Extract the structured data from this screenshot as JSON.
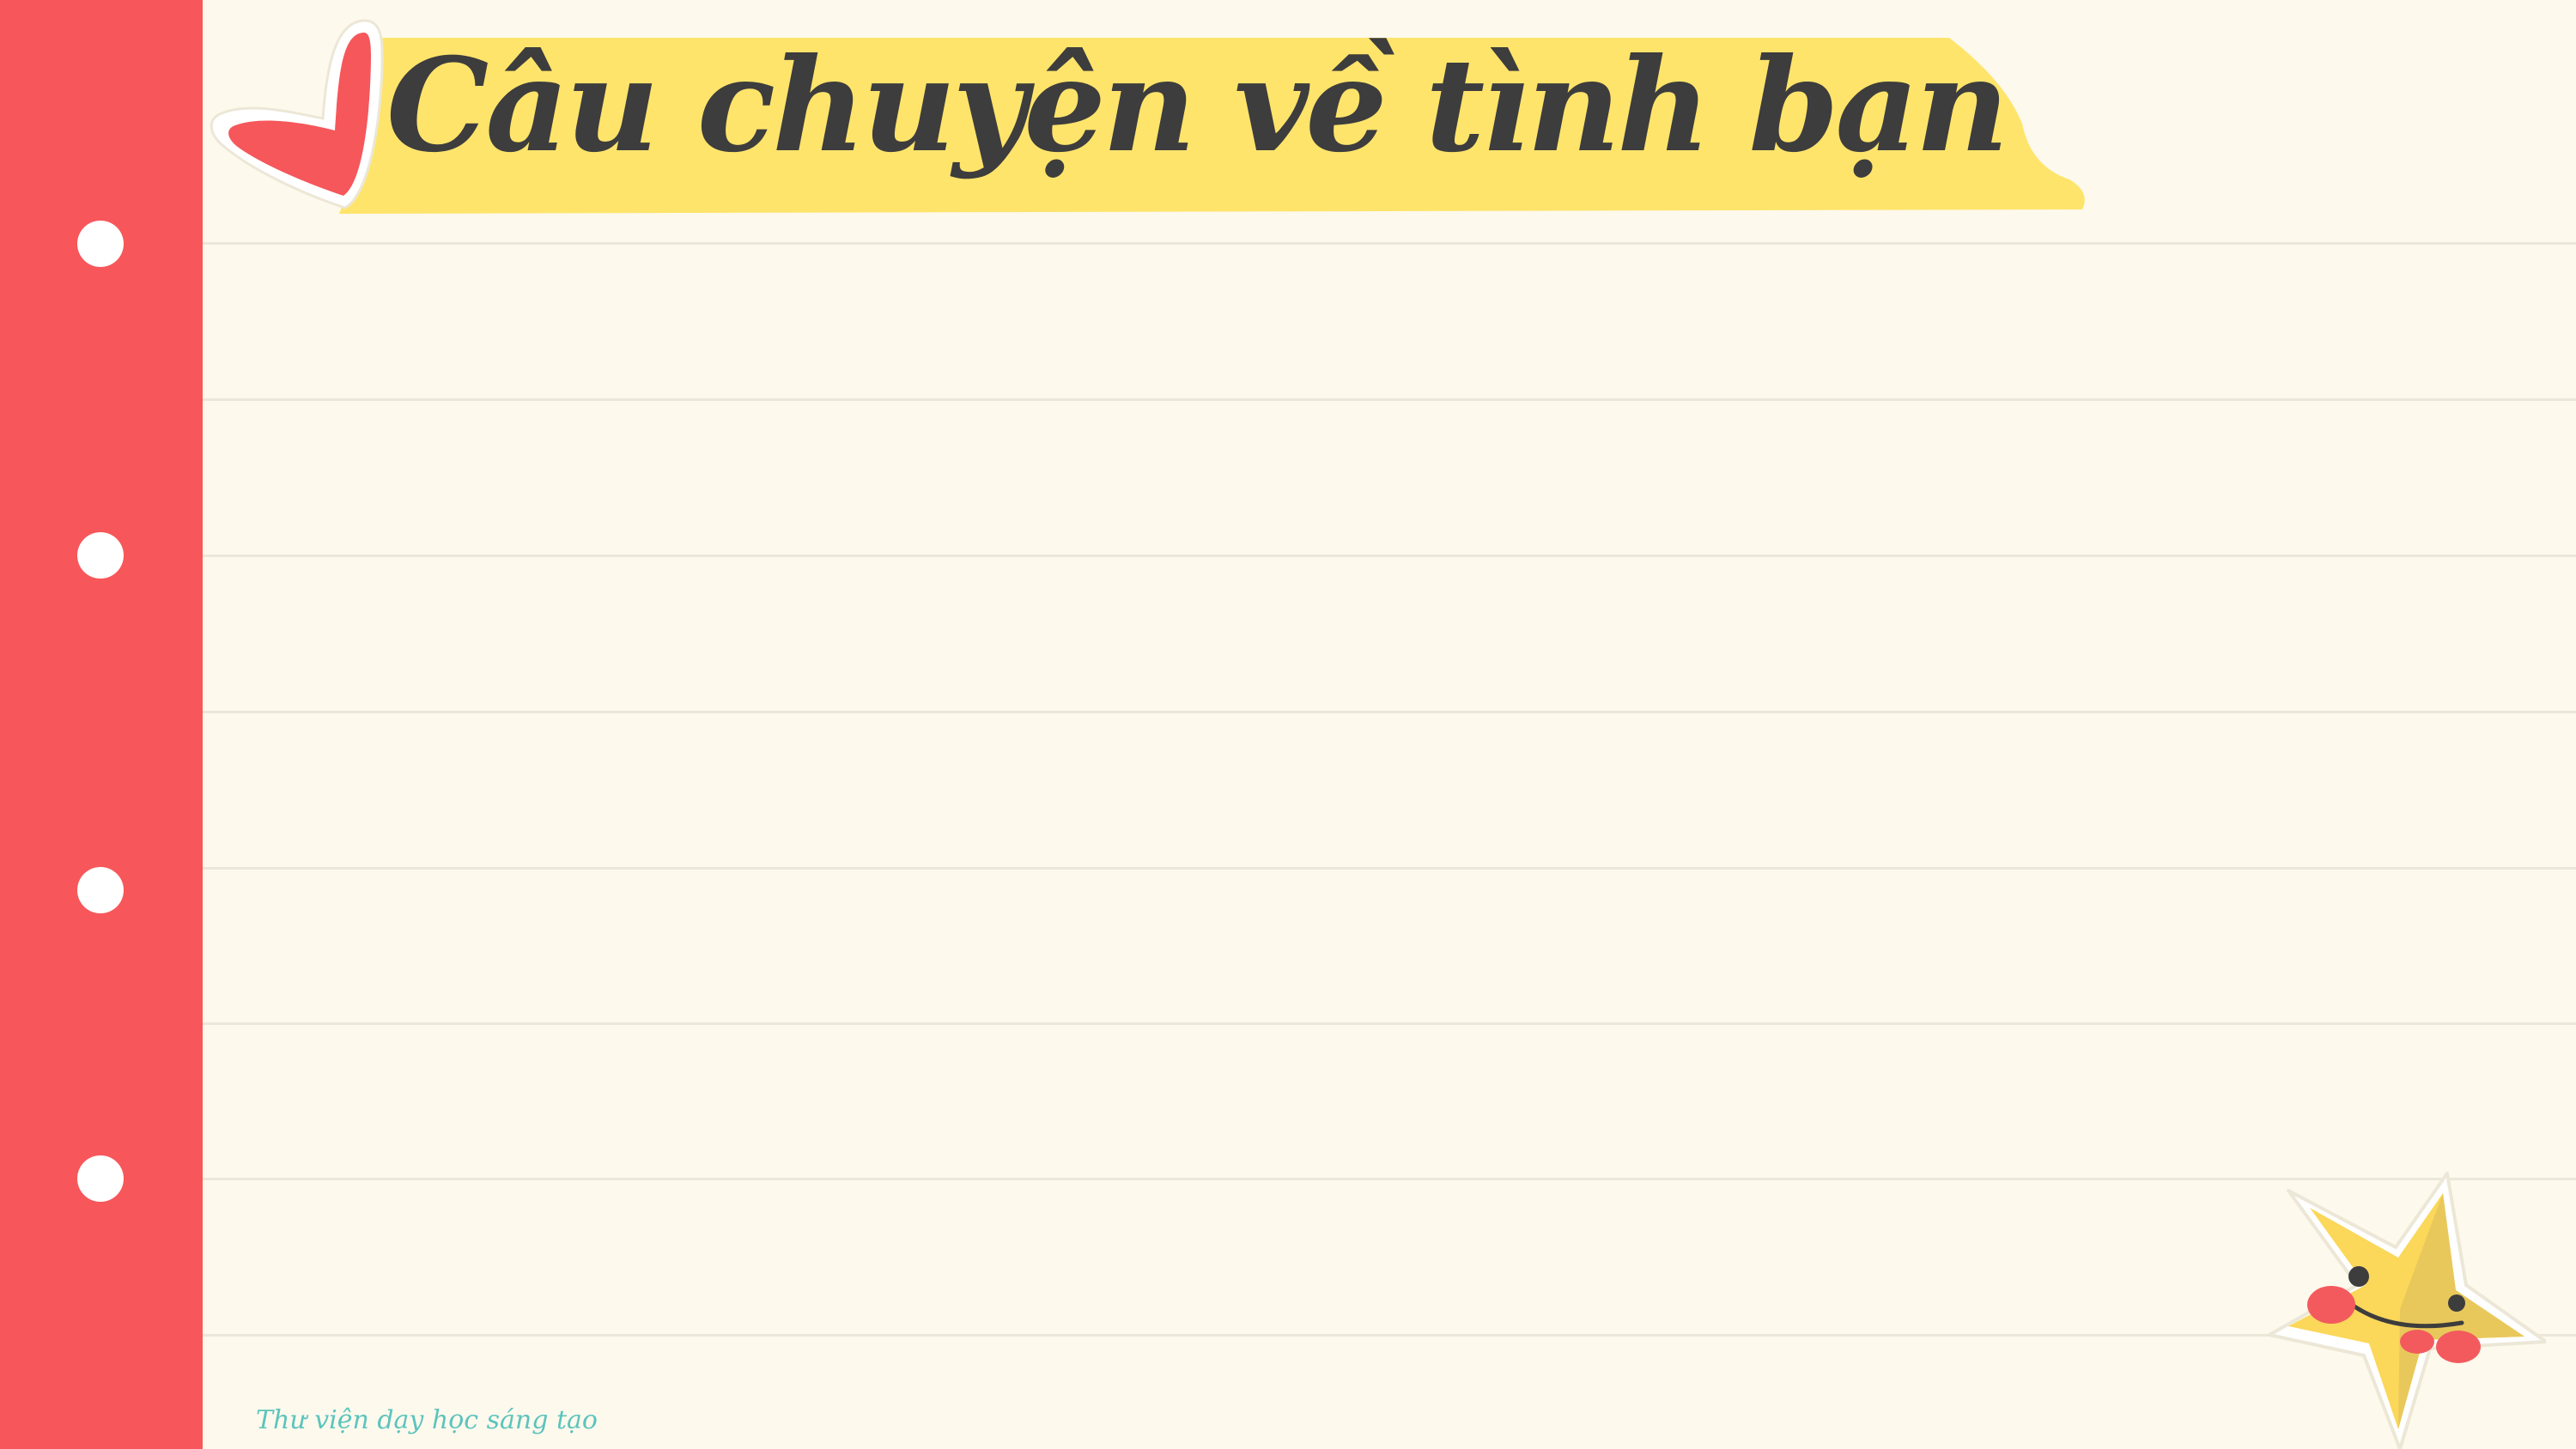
{
  "slide": {
    "title": "Câu chuyện về tình bạn",
    "footer": "Thư viện dạy học sáng tạo"
  },
  "decorations": {
    "heart": "heart-icon",
    "star": "star-mascot-icon",
    "margin_holes": 4
  },
  "colors": {
    "background": "#fdf9ec",
    "margin_strip": "#f7575a",
    "banner": "#ffe46b",
    "title_text": "#3d3d3d",
    "footer_text": "#5cc4bd",
    "star": "#fbd75a"
  }
}
